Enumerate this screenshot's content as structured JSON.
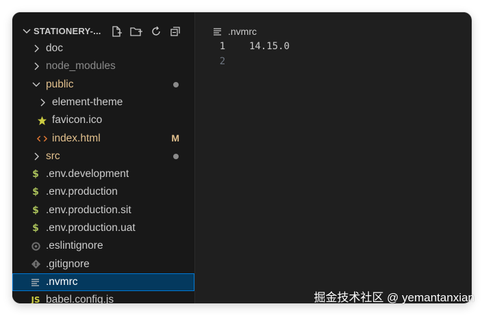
{
  "explorer": {
    "title": "STATIONERY-...",
    "actions": [
      "new-file-icon",
      "new-folder-icon",
      "refresh-icon",
      "collapse-all-icon"
    ]
  },
  "tree": [
    {
      "name": "doc",
      "type": "folder",
      "state": "collapsed",
      "depth": 0,
      "label_color": "#cccccc"
    },
    {
      "name": "node_modules",
      "type": "folder",
      "state": "collapsed",
      "depth": 0,
      "label_color": "#8b8b8b"
    },
    {
      "name": "public",
      "type": "folder",
      "state": "expanded",
      "depth": 0,
      "label_color": "#e2c08d",
      "decoration": "dot"
    },
    {
      "name": "element-theme",
      "type": "folder",
      "state": "collapsed",
      "depth": 1,
      "label_color": "#cccccc"
    },
    {
      "name": "favicon.ico",
      "type": "file",
      "icon": "star-icon",
      "icon_color": "#cbcb41",
      "depth": 1,
      "label_color": "#cccccc"
    },
    {
      "name": "index.html",
      "type": "file",
      "icon": "code-brackets-icon",
      "icon_color": "#e37933",
      "depth": 1,
      "label_color": "#e2c08d",
      "decoration": "M"
    },
    {
      "name": "src",
      "type": "folder",
      "state": "collapsed",
      "depth": 0,
      "label_color": "#e2c08d",
      "decoration": "dot"
    },
    {
      "name": ".env.development",
      "type": "file",
      "icon": "dollar-icon",
      "icon_color": "#a9c05a",
      "depth": 0,
      "label_color": "#cccccc"
    },
    {
      "name": ".env.production",
      "type": "file",
      "icon": "dollar-icon",
      "icon_color": "#a9c05a",
      "depth": 0,
      "label_color": "#cccccc"
    },
    {
      "name": ".env.production.sit",
      "type": "file",
      "icon": "dollar-icon",
      "icon_color": "#a9c05a",
      "depth": 0,
      "label_color": "#cccccc"
    },
    {
      "name": ".env.production.uat",
      "type": "file",
      "icon": "dollar-icon",
      "icon_color": "#a9c05a",
      "depth": 0,
      "label_color": "#cccccc"
    },
    {
      "name": ".eslintignore",
      "type": "file",
      "icon": "gear-icon",
      "icon_color": "#6d6d6d",
      "depth": 0,
      "label_color": "#cccccc"
    },
    {
      "name": ".gitignore",
      "type": "file",
      "icon": "git-icon",
      "icon_color": "#6d6d6d",
      "depth": 0,
      "label_color": "#cccccc"
    },
    {
      "name": ".nvmrc",
      "type": "file",
      "icon": "lines-icon",
      "icon_color": "#c5c5c5",
      "depth": 0,
      "label_color": "#ffffff",
      "selected": true
    },
    {
      "name": "babel.config.js",
      "type": "file",
      "icon": "js-icon",
      "icon_color": "#cbcb41",
      "depth": 0,
      "label_color": "#cccccc"
    }
  ],
  "editor": {
    "breadcrumb": ".nvmrc",
    "lines": [
      {
        "num": "1",
        "text": "14.15.0",
        "active": true
      },
      {
        "num": "2",
        "text": "",
        "active": false
      }
    ]
  },
  "watermark": "掘金技术社区 @ yemantanxian",
  "colors": {
    "background": "#1f1f1f",
    "sidebar": "#181818",
    "selection": "#04395e",
    "selection_border": "#0078d4",
    "modified": "#e2c08d"
  }
}
